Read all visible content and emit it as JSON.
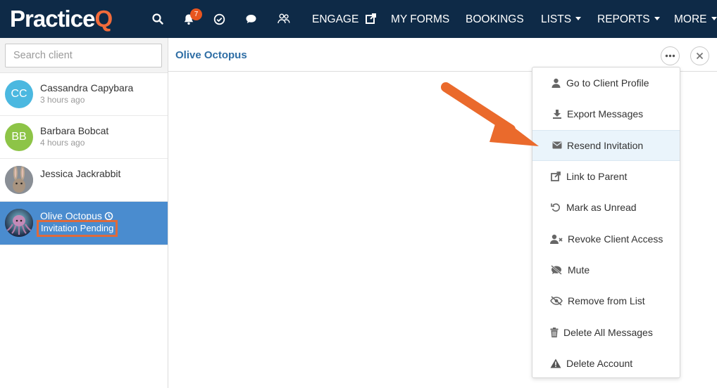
{
  "app": {
    "logo_text_main": "Practice",
    "logo_text_accent": "Q"
  },
  "nav": {
    "notification_count": "7",
    "items": [
      {
        "label": "ENGAGE"
      },
      {
        "label": "MY FORMS"
      },
      {
        "label": "BOOKINGS"
      },
      {
        "label": "LISTS"
      },
      {
        "label": "REPORTS"
      },
      {
        "label": "MORE"
      }
    ],
    "icons": [
      "search-icon",
      "bell-icon",
      "check-circle-icon",
      "chat-icon",
      "people-icon",
      "external-link-icon"
    ]
  },
  "sidebar": {
    "search_placeholder": "Search client",
    "clients": [
      {
        "initials": "CC",
        "name": "Cassandra Capybara",
        "time": "3 hours ago",
        "color": "#4bb8e0"
      },
      {
        "initials": "BB",
        "name": "Barbara Bobcat",
        "time": "4 hours ago",
        "color": "#8dc447"
      },
      {
        "initials": "",
        "name": "Jessica Jackrabbit",
        "time": ""
      },
      {
        "initials": "",
        "name": "Olive Octopus",
        "status": "Invitation Pending"
      }
    ]
  },
  "main": {
    "title": "Olive Octopus"
  },
  "menu": {
    "items": [
      {
        "label": "Go to Client Profile",
        "icon": "user-icon"
      },
      {
        "label": "Export Messages",
        "icon": "download-icon"
      },
      {
        "label": "Resend Invitation",
        "icon": "envelope-icon"
      },
      {
        "label": "Link to Parent",
        "icon": "external-link-icon"
      },
      {
        "label": "Mark as Unread",
        "icon": "undo-icon"
      },
      {
        "label": "Revoke Client Access",
        "icon": "user-remove-icon"
      },
      {
        "label": "Mute",
        "icon": "mute-icon"
      },
      {
        "label": "Remove from List",
        "icon": "eye-slash-icon"
      },
      {
        "label": "Delete All Messages",
        "icon": "trash-icon"
      },
      {
        "label": "Delete Account",
        "icon": "warning-icon"
      }
    ]
  },
  "colors": {
    "nav_bg": "#0e2a47",
    "accent": "#f26b3a",
    "active_row": "#4a8ccf",
    "title": "#2f6ea5"
  }
}
